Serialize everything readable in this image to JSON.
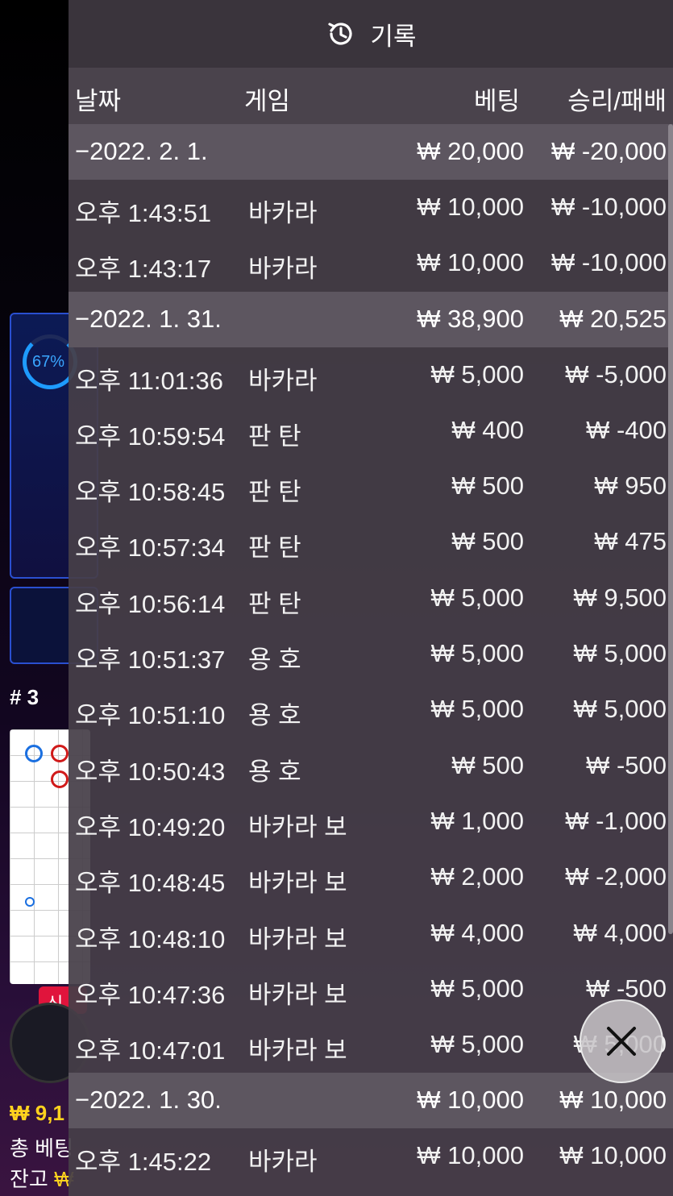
{
  "background": {
    "progress_label": "67%",
    "progress_value": 0.67,
    "table_number": "# 3",
    "badge_label": "신",
    "balance_amount": "₩ 9,1",
    "total_bet_label": "총 베팅",
    "balance_label": "잔고",
    "balance_currency": "₩"
  },
  "history": {
    "title": "기록",
    "columns": {
      "date": "날짜",
      "game": "게임",
      "bet": "베팅",
      "result": "승리/패배"
    },
    "rows": [
      {
        "type": "date",
        "time": "−2022. 2. 1.",
        "game": "",
        "bet": "₩ 20,000",
        "result": "₩ -20,000"
      },
      {
        "type": "item",
        "time": "오후 1:43:51",
        "game": "바카라",
        "bet": "₩ 10,000",
        "result": "₩ -10,000"
      },
      {
        "type": "item",
        "time": "오후 1:43:17",
        "game": "바카라",
        "bet": "₩ 10,000",
        "result": "₩ -10,000"
      },
      {
        "type": "date",
        "time": "−2022. 1. 31.",
        "game": "",
        "bet": "₩ 38,900",
        "result": "₩ 20,525"
      },
      {
        "type": "item",
        "time": "오후 11:01:36",
        "game": "바카라",
        "bet": "₩ 5,000",
        "result": "₩ -5,000"
      },
      {
        "type": "item",
        "time": "오후 10:59:54",
        "game": "판 탄",
        "bet": "₩ 400",
        "result": "₩ -400"
      },
      {
        "type": "item",
        "time": "오후 10:58:45",
        "game": "판 탄",
        "bet": "₩ 500",
        "result": "₩ 950"
      },
      {
        "type": "item",
        "time": "오후 10:57:34",
        "game": "판 탄",
        "bet": "₩ 500",
        "result": "₩ 475"
      },
      {
        "type": "item",
        "time": "오후 10:56:14",
        "game": "판 탄",
        "bet": "₩ 5,000",
        "result": "₩ 9,500"
      },
      {
        "type": "item",
        "time": "오후 10:51:37",
        "game": "용 호",
        "bet": "₩ 5,000",
        "result": "₩ 5,000"
      },
      {
        "type": "item",
        "time": "오후 10:51:10",
        "game": "용 호",
        "bet": "₩ 5,000",
        "result": "₩ 5,000"
      },
      {
        "type": "item",
        "time": "오후 10:50:43",
        "game": "용 호",
        "bet": "₩ 500",
        "result": "₩ -500"
      },
      {
        "type": "item",
        "time": "오후 10:49:20",
        "game": "바카라 보",
        "bet": "₩ 1,000",
        "result": "₩ -1,000"
      },
      {
        "type": "item",
        "time": "오후 10:48:45",
        "game": "바카라 보",
        "bet": "₩ 2,000",
        "result": "₩ -2,000"
      },
      {
        "type": "item",
        "time": "오후 10:48:10",
        "game": "바카라 보",
        "bet": "₩ 4,000",
        "result": "₩ 4,000"
      },
      {
        "type": "item",
        "time": "오후 10:47:36",
        "game": "바카라 보",
        "bet": "₩ 5,000",
        "result": "₩ -500"
      },
      {
        "type": "item",
        "time": "오후 10:47:01",
        "game": "바카라 보",
        "bet": "₩ 5,000",
        "result": "₩ 5,000"
      },
      {
        "type": "date",
        "time": "−2022. 1. 30.",
        "game": "",
        "bet": "₩ 10,000",
        "result": "₩ 10,000"
      },
      {
        "type": "item",
        "time": "오후 1:45:22",
        "game": "바카라",
        "bet": "₩ 10,000",
        "result": "₩ 10,000"
      }
    ]
  },
  "icons": {
    "history": "history-clock-icon",
    "close": "close-icon"
  },
  "colors": {
    "panel_bg": "#463e48",
    "header_bg": "#3a343c",
    "date_row_bg": "#5d5660",
    "accent_blue": "#1e9bff",
    "money_yellow": "#ffd21e"
  }
}
